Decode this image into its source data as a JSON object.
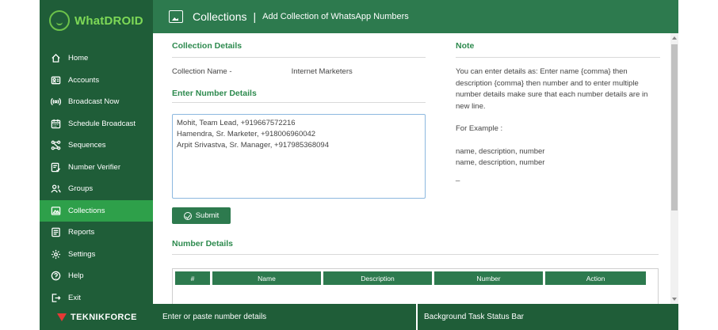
{
  "app": {
    "logo_prefix": "What",
    "logo_suffix": "DROID",
    "brand": "TEKNIKFORCE"
  },
  "sidebar": {
    "items": [
      {
        "label": "Home",
        "icon": "home-icon"
      },
      {
        "label": "Accounts",
        "icon": "accounts-icon"
      },
      {
        "label": "Broadcast Now",
        "icon": "broadcast-icon"
      },
      {
        "label": "Schedule Broadcast",
        "icon": "calendar-icon"
      },
      {
        "label": "Sequences",
        "icon": "sequences-icon"
      },
      {
        "label": "Number Verifier",
        "icon": "verifier-icon"
      },
      {
        "label": "Groups",
        "icon": "groups-icon"
      },
      {
        "label": "Collections",
        "icon": "collections-icon",
        "active": true
      },
      {
        "label": "Reports",
        "icon": "reports-icon"
      },
      {
        "label": "Settings",
        "icon": "gear-icon"
      },
      {
        "label": "Help",
        "icon": "help-icon"
      },
      {
        "label": "Exit",
        "icon": "exit-icon"
      }
    ]
  },
  "header": {
    "title": "Collections",
    "separator": "|",
    "subtitle": "Add Collection of WhatsApp Numbers"
  },
  "collection": {
    "section_title": "Collection Details",
    "name_label": "Collection Name -",
    "name_value": "Internet  Marketers",
    "enter_title": "Enter Number Details",
    "textarea_value": "Mohit, Team Lead, +919667572216\nHamendra, Sr. Marketer, +918006960042\nArpit Srivastva, Sr. Manager, +917985368094",
    "submit_label": "Submit"
  },
  "note": {
    "title": "Note",
    "paragraph": "You can enter details as: Enter name {comma} then description {comma} then number and to enter multiple number details make sure that each number details are in new line.",
    "example_label": "For Example :",
    "example_line1": "name, description, number",
    "example_line2": "name, description, number",
    "example_line3": "_"
  },
  "number_details": {
    "title": "Number Details",
    "columns": [
      "#",
      "Name",
      "Description",
      "Number",
      "Action"
    ]
  },
  "footer": {
    "left": "Enter or paste number details",
    "right": "Background Task Status Bar"
  },
  "colors": {
    "sidebar": "#1f5d38",
    "header": "#2d7a4e",
    "active": "#2ea04a",
    "accent": "#2d8a4e"
  }
}
